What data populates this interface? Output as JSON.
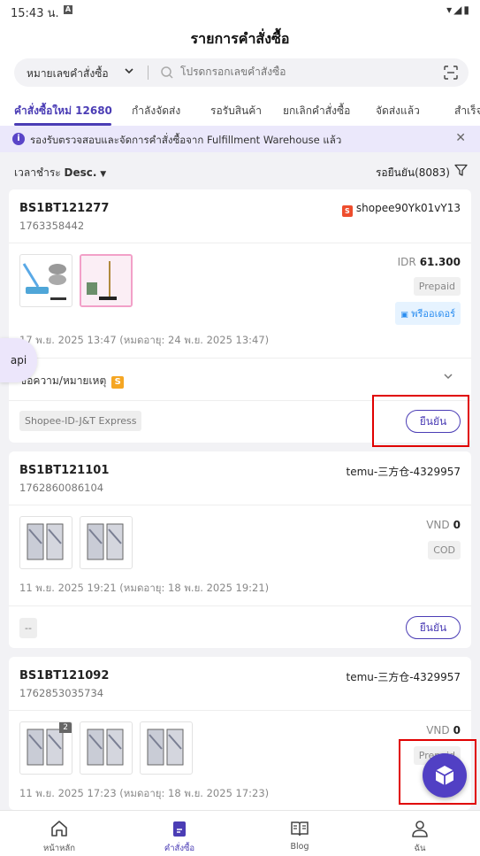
{
  "status_bar": {
    "time": "15:43 น.",
    "a_icon": "A",
    "system_icons": "▾◢▮"
  },
  "header": {
    "title": "รายการคำสั่งซื้อ"
  },
  "search": {
    "type_label": "หมายเลขคำสั่งซื้อ",
    "placeholder": "โปรดกรอกเลขคำสั่งซื้อ"
  },
  "tabs": [
    {
      "label": "คำสั่งซื้อใหม่ 12680",
      "active": true
    },
    {
      "label": "กำลังจัดส่ง"
    },
    {
      "label": "รอรับสินค้า"
    },
    {
      "label": "ยกเลิกคำสั่งซื้อ"
    },
    {
      "label": "จัดส่งแล้ว"
    },
    {
      "label": "สำเร็จ"
    }
  ],
  "banner": {
    "info_icon": "i",
    "text": "รองรับตรวจสอบและจัดการคำสั่งซื้อจาก Fulfillment Warehouse แล้ว",
    "close": "✕"
  },
  "sort": {
    "label": "เวลาชำระ",
    "order": "Desc.",
    "pending": "รอยืนยัน(8083)"
  },
  "orders": [
    {
      "order_no": "BS1BT121277",
      "order_id": "1763358442",
      "shop_icon": "S",
      "store": "shopee90Yk01vY13",
      "currency": "IDR",
      "amount": "61.300",
      "tags": [
        "Prepaid",
        "พรีออเดอร์"
      ],
      "dates": "17 พ.ย. 2025 13:47  (หมดอายุ:  24 พ.ย. 2025 13:47)",
      "note": "ข้อความ/หมายเหตุ",
      "note_badge": "S",
      "carrier": "Shopee-ID-J&T Express",
      "confirm": "ยืนยัน"
    },
    {
      "order_no": "BS1BT121101",
      "order_id": "1762860086104",
      "store": "temu-三方仓-4329957",
      "currency": "VND",
      "amount": "0",
      "tags": [
        "COD"
      ],
      "dates": "11 พ.ย. 2025 19:21  (หมดอายุ:  18 พ.ย. 2025 19:21)",
      "carrier": "--",
      "confirm": "ยืนยัน"
    },
    {
      "order_no": "BS1BT121092",
      "order_id": "1762853035734",
      "store": "temu-三方仓-4329957",
      "currency": "VND",
      "amount": "0",
      "item_count_badge": "2",
      "tags": [
        "Prepaid"
      ],
      "dates": "11 พ.ย. 2025 17:23  (หมดอายุ:  18 พ.ย. 2025 17:23)"
    }
  ],
  "fab": {
    "api_label": "api"
  },
  "bottom_nav": [
    {
      "label": "หน้าหลัก"
    },
    {
      "label": "คำสั่งซื้อ",
      "active": true
    },
    {
      "label": "Blog"
    },
    {
      "label": "ฉัน"
    }
  ],
  "colors": {
    "accent": "#4b3db5",
    "highlight": "#e00000",
    "shopee": "#ee4d2d"
  }
}
